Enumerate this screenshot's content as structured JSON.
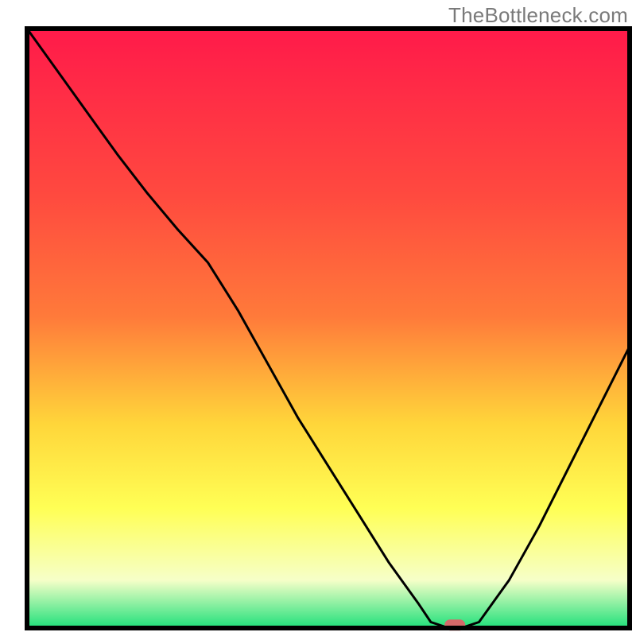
{
  "watermark": "TheBottleneck.com",
  "colors": {
    "gradient_top": "#ff1a4a",
    "gradient_mid_upper": "#ff7a3a",
    "gradient_mid": "#ffd63a",
    "gradient_mid_lower": "#ffff55",
    "gradient_lower": "#f6ffc8",
    "gradient_bottom": "#1fe07a",
    "curve": "#000000",
    "axis": "#000000",
    "marker": "#d46a6a"
  },
  "chart_data": {
    "type": "line",
    "title": "",
    "xlabel": "",
    "ylabel": "",
    "xlim": [
      0,
      100
    ],
    "ylim": [
      0,
      100
    ],
    "x": [
      0,
      5,
      10,
      15,
      20,
      25,
      30,
      35,
      40,
      45,
      50,
      55,
      60,
      65,
      67,
      70,
      72,
      75,
      80,
      85,
      90,
      95,
      100
    ],
    "values": [
      100,
      93,
      86,
      79,
      72.5,
      66.5,
      61,
      53,
      44,
      35,
      27,
      19,
      11,
      4,
      1,
      0,
      0,
      1,
      8,
      17,
      27,
      37,
      47
    ],
    "marker": {
      "x": 71,
      "y": 0.5
    },
    "annotations": []
  }
}
